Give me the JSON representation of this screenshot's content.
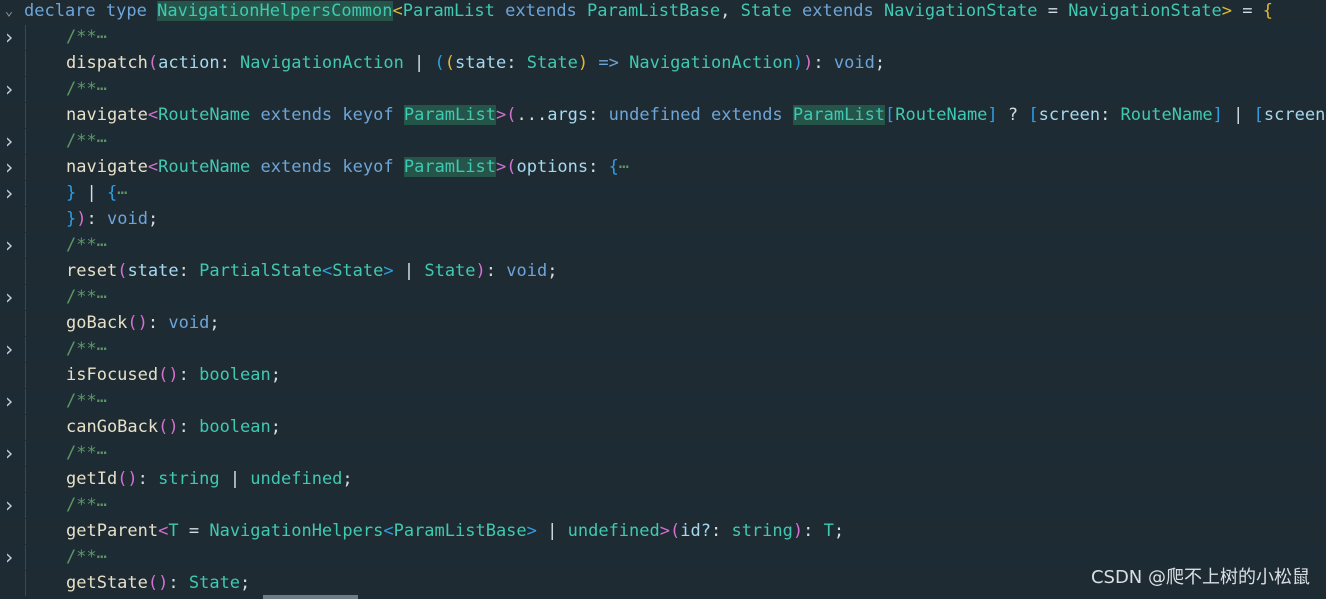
{
  "colors": {
    "background": "#1e2b33",
    "keyword": "#6ea5d8",
    "type": "#40c9b2",
    "comment": "#5f9a64",
    "highlight": "#255449",
    "bracket_yellow": "#e4ba2c",
    "bracket_magenta": "#d470d1",
    "bracket_blue": "#2e9fe5"
  },
  "watermark": "CSDN @爬不上树的小松鼠",
  "lines": [
    {
      "fold": "expanded",
      "indent": 0,
      "tokens": [
        [
          "kw",
          "declare"
        ],
        [
          "p",
          " "
        ],
        [
          "kw",
          "type"
        ],
        [
          "p",
          " "
        ],
        [
          "hl",
          "NavigationHelpersCommon"
        ],
        [
          "br1",
          "<"
        ],
        [
          "type",
          "ParamList"
        ],
        [
          "p",
          " "
        ],
        [
          "kw",
          "extends"
        ],
        [
          "p",
          " "
        ],
        [
          "type",
          "ParamListBase"
        ],
        [
          "p",
          ", "
        ],
        [
          "type",
          "State"
        ],
        [
          "p",
          " "
        ],
        [
          "kw",
          "extends"
        ],
        [
          "p",
          " "
        ],
        [
          "type",
          "NavigationState"
        ],
        [
          "p",
          " = "
        ],
        [
          "type",
          "NavigationState"
        ],
        [
          "br1",
          ">"
        ],
        [
          "p",
          " = "
        ],
        [
          "br1",
          "{"
        ]
      ]
    },
    {
      "fold": "collapsed",
      "indent": 1,
      "tokens": [
        [
          "comment",
          "/**"
        ],
        [
          "comment",
          "⋯"
        ]
      ]
    },
    {
      "fold": "none",
      "indent": 1,
      "tokens": [
        [
          "fn",
          "dispatch"
        ],
        [
          "br2",
          "("
        ],
        [
          "param",
          "action"
        ],
        [
          "p",
          ": "
        ],
        [
          "type",
          "NavigationAction"
        ],
        [
          "p",
          " | "
        ],
        [
          "br3",
          "("
        ],
        [
          "br1",
          "("
        ],
        [
          "param",
          "state"
        ],
        [
          "p",
          ": "
        ],
        [
          "type",
          "State"
        ],
        [
          "br1",
          ")"
        ],
        [
          "p",
          " "
        ],
        [
          "kw",
          "=>"
        ],
        [
          "p",
          " "
        ],
        [
          "type",
          "NavigationAction"
        ],
        [
          "br3",
          ")"
        ],
        [
          "br2",
          ")"
        ],
        [
          "p",
          ": "
        ],
        [
          "kw",
          "void"
        ],
        [
          "p",
          ";"
        ]
      ]
    },
    {
      "fold": "collapsed",
      "indent": 1,
      "tokens": [
        [
          "comment",
          "/**"
        ],
        [
          "comment",
          "⋯"
        ]
      ]
    },
    {
      "fold": "none",
      "indent": 1,
      "tokens": [
        [
          "fn",
          "navigate"
        ],
        [
          "br2",
          "<"
        ],
        [
          "type",
          "RouteName"
        ],
        [
          "p",
          " "
        ],
        [
          "kw",
          "extends"
        ],
        [
          "p",
          " "
        ],
        [
          "kw",
          "keyof"
        ],
        [
          "p",
          " "
        ],
        [
          "hl",
          "ParamList"
        ],
        [
          "br2",
          ">"
        ],
        [
          "br2",
          "("
        ],
        [
          "p",
          "..."
        ],
        [
          "param",
          "args"
        ],
        [
          "p",
          ": "
        ],
        [
          "kw",
          "undefined"
        ],
        [
          "p",
          " "
        ],
        [
          "kw",
          "extends"
        ],
        [
          "p",
          " "
        ],
        [
          "hl",
          "ParamList"
        ],
        [
          "br3",
          "["
        ],
        [
          "type",
          "RouteName"
        ],
        [
          "br3",
          "]"
        ],
        [
          "p",
          " ? "
        ],
        [
          "br3",
          "["
        ],
        [
          "param",
          "screen"
        ],
        [
          "p",
          ": "
        ],
        [
          "type",
          "RouteName"
        ],
        [
          "br3",
          "]"
        ],
        [
          "p",
          " | "
        ],
        [
          "br3",
          "["
        ],
        [
          "param",
          "screen"
        ]
      ]
    },
    {
      "fold": "collapsed",
      "indent": 1,
      "tokens": [
        [
          "comment",
          "/**"
        ],
        [
          "comment",
          "⋯"
        ]
      ]
    },
    {
      "fold": "collapsed",
      "indent": 1,
      "tokens": [
        [
          "fn",
          "navigate"
        ],
        [
          "br2",
          "<"
        ],
        [
          "type",
          "RouteName"
        ],
        [
          "p",
          " "
        ],
        [
          "kw",
          "extends"
        ],
        [
          "p",
          " "
        ],
        [
          "kw",
          "keyof"
        ],
        [
          "p",
          " "
        ],
        [
          "hl",
          "ParamList"
        ],
        [
          "br2",
          ">"
        ],
        [
          "br2",
          "("
        ],
        [
          "param",
          "options"
        ],
        [
          "p",
          ": "
        ],
        [
          "br3",
          "{"
        ],
        [
          "comment",
          "⋯"
        ]
      ]
    },
    {
      "fold": "collapsed",
      "indent": 1,
      "tokens": [
        [
          "br3",
          "}"
        ],
        [
          "p",
          " | "
        ],
        [
          "br3",
          "{"
        ],
        [
          "comment",
          "⋯"
        ]
      ]
    },
    {
      "fold": "none",
      "indent": 1,
      "tokens": [
        [
          "br3",
          "}"
        ],
        [
          "br2",
          ")"
        ],
        [
          "p",
          ": "
        ],
        [
          "kw",
          "void"
        ],
        [
          "p",
          ";"
        ]
      ]
    },
    {
      "fold": "collapsed",
      "indent": 1,
      "tokens": [
        [
          "comment",
          "/**"
        ],
        [
          "comment",
          "⋯"
        ]
      ]
    },
    {
      "fold": "none",
      "indent": 1,
      "tokens": [
        [
          "fn",
          "reset"
        ],
        [
          "br2",
          "("
        ],
        [
          "param",
          "state"
        ],
        [
          "p",
          ": "
        ],
        [
          "type",
          "PartialState"
        ],
        [
          "br3",
          "<"
        ],
        [
          "type",
          "State"
        ],
        [
          "br3",
          ">"
        ],
        [
          "p",
          " | "
        ],
        [
          "type",
          "State"
        ],
        [
          "br2",
          ")"
        ],
        [
          "p",
          ": "
        ],
        [
          "kw",
          "void"
        ],
        [
          "p",
          ";"
        ]
      ]
    },
    {
      "fold": "collapsed",
      "indent": 1,
      "tokens": [
        [
          "comment",
          "/**"
        ],
        [
          "comment",
          "⋯"
        ]
      ]
    },
    {
      "fold": "none",
      "indent": 1,
      "tokens": [
        [
          "fn",
          "goBack"
        ],
        [
          "br2",
          "()"
        ],
        [
          "p",
          ": "
        ],
        [
          "kw",
          "void"
        ],
        [
          "p",
          ";"
        ]
      ]
    },
    {
      "fold": "collapsed",
      "indent": 1,
      "tokens": [
        [
          "comment",
          "/**"
        ],
        [
          "comment",
          "⋯"
        ]
      ]
    },
    {
      "fold": "none",
      "indent": 1,
      "tokens": [
        [
          "fn",
          "isFocused"
        ],
        [
          "br2",
          "()"
        ],
        [
          "p",
          ": "
        ],
        [
          "type",
          "boolean"
        ],
        [
          "p",
          ";"
        ]
      ]
    },
    {
      "fold": "collapsed",
      "indent": 1,
      "tokens": [
        [
          "comment",
          "/**"
        ],
        [
          "comment",
          "⋯"
        ]
      ]
    },
    {
      "fold": "none",
      "indent": 1,
      "tokens": [
        [
          "fn",
          "canGoBack"
        ],
        [
          "br2",
          "()"
        ],
        [
          "p",
          ": "
        ],
        [
          "type",
          "boolean"
        ],
        [
          "p",
          ";"
        ]
      ]
    },
    {
      "fold": "collapsed",
      "indent": 1,
      "tokens": [
        [
          "comment",
          "/**"
        ],
        [
          "comment",
          "⋯"
        ]
      ]
    },
    {
      "fold": "none",
      "indent": 1,
      "tokens": [
        [
          "fn",
          "getId"
        ],
        [
          "br2",
          "()"
        ],
        [
          "p",
          ": "
        ],
        [
          "type",
          "string"
        ],
        [
          "p",
          " | "
        ],
        [
          "type",
          "undefined"
        ],
        [
          "p",
          ";"
        ]
      ]
    },
    {
      "fold": "collapsed",
      "indent": 1,
      "tokens": [
        [
          "comment",
          "/**"
        ],
        [
          "comment",
          "⋯"
        ]
      ]
    },
    {
      "fold": "none",
      "indent": 1,
      "tokens": [
        [
          "fn",
          "getParent"
        ],
        [
          "br2",
          "<"
        ],
        [
          "type",
          "T"
        ],
        [
          "p",
          " = "
        ],
        [
          "type",
          "NavigationHelpers"
        ],
        [
          "br3",
          "<"
        ],
        [
          "type",
          "ParamListBase"
        ],
        [
          "br3",
          ">"
        ],
        [
          "p",
          " | "
        ],
        [
          "type",
          "undefined"
        ],
        [
          "br2",
          ">"
        ],
        [
          "br2",
          "("
        ],
        [
          "param",
          "id?"
        ],
        [
          "p",
          ": "
        ],
        [
          "type",
          "string"
        ],
        [
          "br2",
          ")"
        ],
        [
          "p",
          ": "
        ],
        [
          "type",
          "T"
        ],
        [
          "p",
          ";"
        ]
      ]
    },
    {
      "fold": "collapsed",
      "indent": 1,
      "tokens": [
        [
          "comment",
          "/**"
        ],
        [
          "comment",
          "⋯"
        ]
      ]
    },
    {
      "fold": "none",
      "indent": 1,
      "tokens": [
        [
          "fn",
          "getState"
        ],
        [
          "br2",
          "()"
        ],
        [
          "p",
          ": "
        ],
        [
          "type",
          "State"
        ],
        [
          "p",
          ";"
        ]
      ]
    }
  ]
}
